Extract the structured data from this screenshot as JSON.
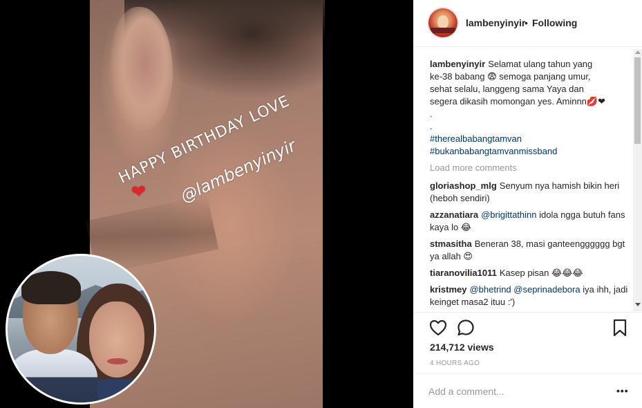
{
  "post": {
    "username": "lambenyinyir",
    "follow_status": "Following",
    "separator": "•",
    "overlay": {
      "line1": "HAPPY BIRTHDAY LOVE",
      "heart": "❤",
      "line2": "@lambenyinyir"
    }
  },
  "caption": {
    "username": "lambenyinyir",
    "lines": [
      "Selamat ulang tahun yang",
      "ke-38 babang 😨 semoga panjang umur,",
      "sehat selalu, langgeng sama Yaya dan",
      "segera dikasih momongan yes. Aminnn💋❤"
    ],
    "dots": [
      ".",
      "."
    ],
    "hashtags": [
      "#therealbabangtamvan",
      "#bukanbabangtamvanmissband"
    ]
  },
  "load_more": "Load more comments",
  "comments": [
    {
      "user": "gloriashop_mlg",
      "mention": "",
      "text": "Senyum nya hamish bikin heri (heboh sendiri)"
    },
    {
      "user": "azzanatiara",
      "mention": "@brigittathinn",
      "text": "idola ngga butuh fans kaya lo 😂"
    },
    {
      "user": "stmasitha",
      "mention": "",
      "text": "Beneran 38, masi ganteengggggg bgt ya allah 😍"
    },
    {
      "user": "tiaranovilia1011",
      "mention": "",
      "text": "Kasep pisan 😂😂😂"
    },
    {
      "user": "kristmey",
      "mention": "@bhetrind @seprinadebora",
      "text": "iya ihh, jadi keinget masa2 ituu :')"
    }
  ],
  "stats": {
    "views": "214,712 views",
    "time": "4 HOURS AGO"
  },
  "input": {
    "placeholder": "Add a comment..."
  },
  "more_label": "•••",
  "icons": {
    "like": "heart-outline-icon",
    "comment": "speech-bubble-icon",
    "save": "bookmark-icon"
  },
  "colors": {
    "hashtag": "#003569",
    "muted": "#999999",
    "text": "#262626"
  }
}
